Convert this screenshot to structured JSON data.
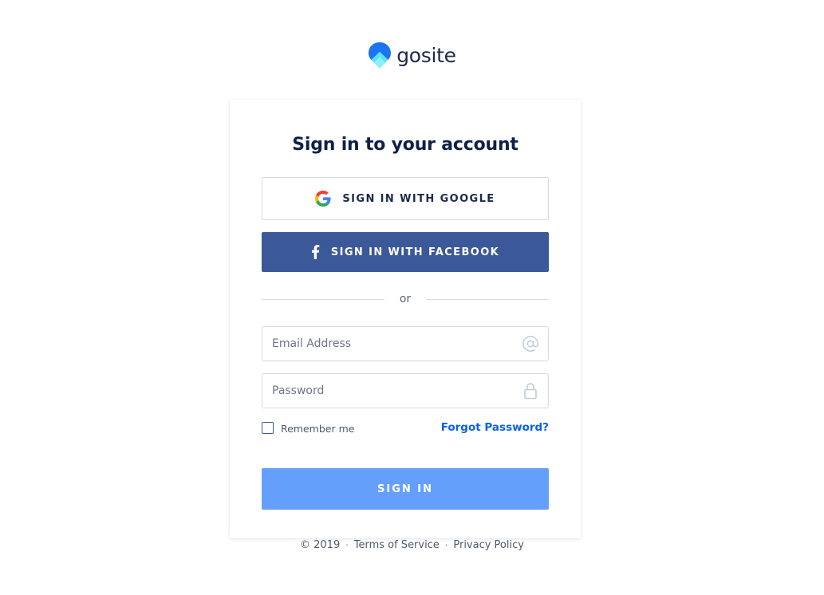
{
  "brand": {
    "name": "gosite",
    "logo_icon": "gosite-logo-icon",
    "colors": {
      "primary_dark": "#1b2a4a",
      "logo_blue": "#1e73f0",
      "logo_light": "#5ce1f5"
    }
  },
  "card": {
    "title": "Sign in to your account"
  },
  "social": {
    "google_label": "SIGN IN WITH GOOGLE",
    "google_icon": "google-icon",
    "facebook_label": "SIGN IN WITH FACEBOOK",
    "facebook_icon": "facebook-icon",
    "facebook_color": "#3b5998"
  },
  "divider": {
    "text": "or"
  },
  "form": {
    "email": {
      "value": "",
      "placeholder": "Email Address",
      "icon": "at-sign-icon"
    },
    "password": {
      "value": "",
      "placeholder": "Password",
      "icon": "lock-icon"
    },
    "remember_label": "Remember me",
    "remember_checked": false,
    "forgot_label": "Forgot Password?",
    "forgot_color": "#0b62e0",
    "submit_label": "SIGN IN",
    "submit_color": "#64a0fb"
  },
  "footer": {
    "copyright": "© 2019",
    "separator": "·",
    "terms_label": "Terms of Service",
    "privacy_label": "Privacy Policy"
  }
}
